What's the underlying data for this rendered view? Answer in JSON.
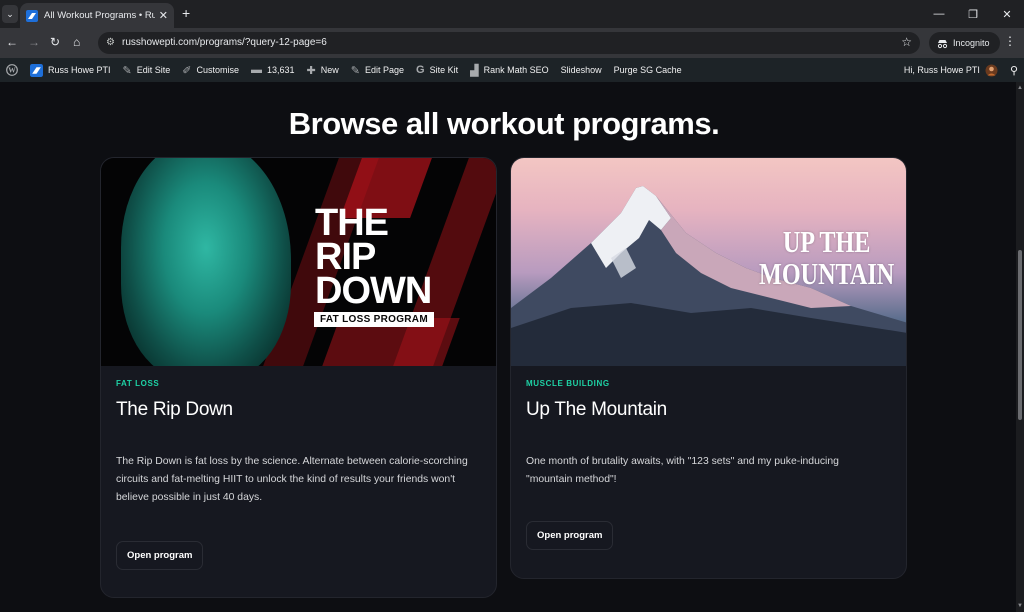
{
  "browser": {
    "tab_title": "All Workout Programs • Russ H",
    "tab_close": "✕",
    "new_tab": "+",
    "url": "russhowepti.com/programs/?query-12-page=6",
    "incognito_label": "Incognito"
  },
  "wp_admin_bar": {
    "site_name": "Russ Howe PTI",
    "edit_site": "Edit Site",
    "customise": "Customise",
    "comments_count": "13,631",
    "new": "New",
    "edit_page": "Edit Page",
    "site_kit": "Site Kit",
    "rank_math": "Rank Math SEO",
    "slideshow": "Slideshow",
    "purge_cache": "Purge SG Cache",
    "greeting": "Hi, Russ Howe PTI"
  },
  "page": {
    "heading": "Browse all workout programs."
  },
  "programs": [
    {
      "category": "FAT LOSS",
      "title": "The Rip Down",
      "image_text": [
        "THE",
        "RIP",
        "DOWN"
      ],
      "image_badge": "FAT LOSS PROGRAM",
      "description": "The Rip Down is fat loss by the science. Alternate between calorie-scorching circuits and fat-melting HIIT to unlock the kind of results your friends won't believe possible in just 40 days.",
      "button": "Open program"
    },
    {
      "category": "MUSCLE BUILDING",
      "title": "Up The Mountain",
      "image_text": [
        "UP THE",
        "MOUNTAIN"
      ],
      "description": "One month of brutality awaits, with \"123 sets\" and my puke-inducing \"mountain method\"!",
      "button": "Open program"
    }
  ],
  "colors": {
    "accent": "#1ed2a5",
    "page_bg": "#0d0e12",
    "card_bg": "#161820"
  }
}
